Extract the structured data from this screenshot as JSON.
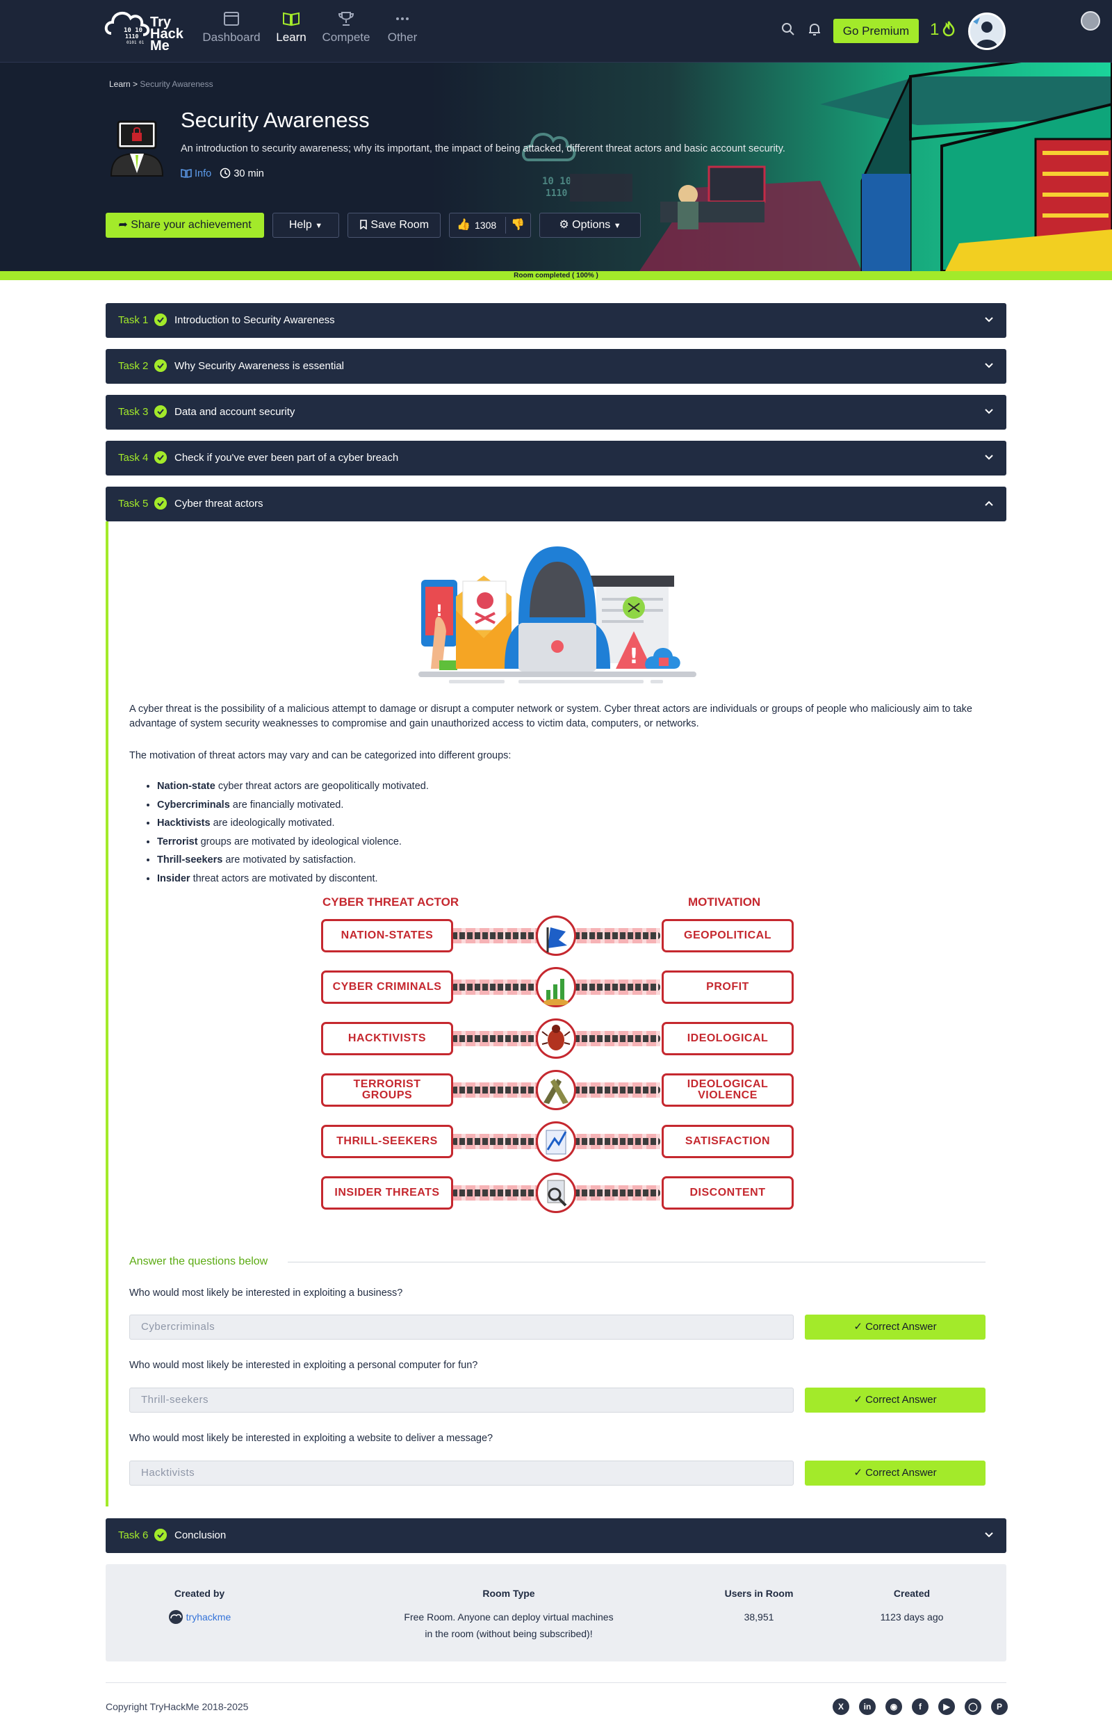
{
  "nav": {
    "logo_lines": [
      "Try",
      "Hack",
      "Me"
    ],
    "items": [
      {
        "label": "Dashboard",
        "icon": "dashboard-icon"
      },
      {
        "label": "Learn",
        "icon": "book-icon"
      },
      {
        "label": "Compete",
        "icon": "trophy-icon"
      },
      {
        "label": "Other",
        "icon": "ellipsis-icon"
      }
    ],
    "premium_label": "Go Premium",
    "streak": "1"
  },
  "breadcrumb": {
    "root": "Learn",
    "separator": ">",
    "current": "Security Awareness"
  },
  "room": {
    "title": "Security Awareness",
    "description": "An introduction to security awareness; why its important, the impact of being attacked, different threat actors and basic account security.",
    "info_label": "Info",
    "duration": "30 min"
  },
  "actions": {
    "share": "Share your achievement",
    "help": "Help",
    "save": "Save Room",
    "likes": "1308",
    "options": "Options"
  },
  "progress": {
    "label": "Room completed ( 100% )",
    "percent": 100
  },
  "tasks": [
    {
      "num": "Task 1",
      "title": "Introduction to Security Awareness"
    },
    {
      "num": "Task 2",
      "title": "Why Security Awareness is essential"
    },
    {
      "num": "Task 3",
      "title": "Data and account security"
    },
    {
      "num": "Task 4",
      "title": "Check if you've ever been part of a cyber breach"
    },
    {
      "num": "Task 5",
      "title": "Cyber threat actors"
    },
    {
      "num": "Task 6",
      "title": "Conclusion"
    }
  ],
  "task5": {
    "para1": "A cyber threat is the possibility of a malicious attempt to damage or disrupt a computer network or system. Cyber threat actors are individuals or groups of people who maliciously aim to take advantage of system security weaknesses to compromise and gain unauthorized access to victim data, computers, or networks.",
    "para2": "The motivation of threat actors may vary and can be categorized into different groups:",
    "bullets": [
      {
        "bold": "Nation-state",
        "rest": " cyber threat actors are geopolitically motivated."
      },
      {
        "bold": "Cybercriminals",
        "rest": " are financially motivated."
      },
      {
        "bold": "Hacktivists",
        "rest": " are ideologically motivated."
      },
      {
        "bold": "Terrorist",
        "rest": " groups are motivated by ideological violence."
      },
      {
        "bold": "Thrill-seekers",
        "rest": " are motivated by satisfaction."
      },
      {
        "bold": "Insider",
        "rest": " threat actors are motivated by discontent."
      }
    ],
    "diagram": {
      "left_header": "CYBER THREAT ACTOR",
      "right_header": "MOTIVATION",
      "rows": [
        {
          "actor": "NATION-STATES",
          "motivation": "GEOPOLITICAL"
        },
        {
          "actor": "CYBER CRIMINALS",
          "motivation": "PROFIT"
        },
        {
          "actor": "HACKTIVISTS",
          "motivation": "IDEOLOGICAL"
        },
        {
          "actor": "TERRORIST GROUPS",
          "motivation": "IDEOLOGICAL VIOLENCE"
        },
        {
          "actor": "THRILL-SEEKERS",
          "motivation": "SATISFACTION"
        },
        {
          "actor": "INSIDER THREATS",
          "motivation": "DISCONTENT"
        }
      ]
    },
    "answer_header": "Answer the questions below",
    "questions": [
      {
        "q": "Who would most likely be interested in exploiting a business?",
        "answer": "Cybercriminals",
        "button": "Correct Answer"
      },
      {
        "q": "Who would most likely be interested in exploiting a personal computer for fun?",
        "answer": "Thrill-seekers",
        "button": "Correct Answer"
      },
      {
        "q": "Who would most likely be interested in exploiting a website to deliver a message?",
        "answer": "Hacktivists",
        "button": "Correct Answer"
      }
    ]
  },
  "room_info": {
    "created_by_h": "Created by",
    "created_by": "tryhackme",
    "room_type_h": "Room Type",
    "room_type_line1": "Free Room. Anyone can deploy virtual machines",
    "room_type_line2": "in the room (without being subscribed)!",
    "users_h": "Users in Room",
    "users": "38,951",
    "created_h": "Created",
    "created": "1123 days ago"
  },
  "footer": {
    "copyright": "Copyright TryHackMe 2018-2025",
    "social": [
      "x-icon",
      "linkedin-icon",
      "discord-icon",
      "facebook-icon",
      "youtube-icon",
      "instagram-icon",
      "pinterest-icon"
    ]
  },
  "colors": {
    "accent": "#a3ea2a",
    "navy": "#212c42",
    "dark": "#161f30",
    "diagram_red": "#c5282f",
    "link": "#3473d9"
  }
}
